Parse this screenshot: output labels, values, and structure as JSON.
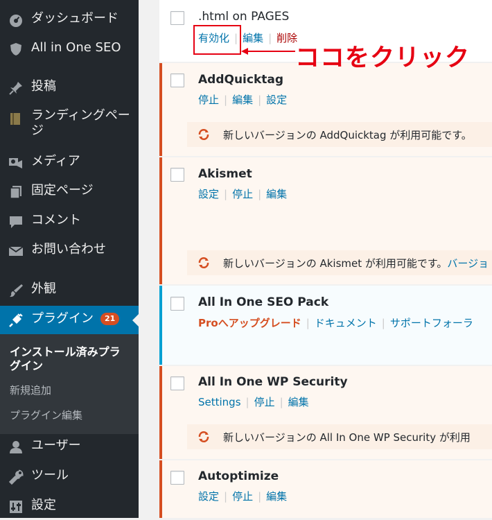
{
  "sidebar": {
    "items": [
      {
        "label": "ダッシュボード",
        "icon": "dashboard-icon"
      },
      {
        "label": "All in One SEO",
        "icon": "shield-icon"
      },
      {
        "label": "投稿",
        "icon": "pin-icon"
      },
      {
        "label": "ランディングページ",
        "icon": "book-icon"
      },
      {
        "label": "メディア",
        "icon": "media-icon"
      },
      {
        "label": "固定ページ",
        "icon": "pages-icon"
      },
      {
        "label": "コメント",
        "icon": "comment-icon"
      },
      {
        "label": "お問い合わせ",
        "icon": "mail-icon"
      },
      {
        "label": "外観",
        "icon": "brush-icon"
      },
      {
        "label": "プラグイン",
        "icon": "plugin-icon",
        "badge": "21"
      },
      {
        "label": "ユーザー",
        "icon": "user-icon"
      },
      {
        "label": "ツール",
        "icon": "wrench-icon"
      },
      {
        "label": "設定",
        "icon": "settings-icon"
      }
    ],
    "submenu": [
      "インストール済みプラグイン",
      "新規追加",
      "プラグイン編集"
    ]
  },
  "plugins": [
    {
      "name": ".html on PAGES",
      "actions": [
        "有効化",
        "編集",
        "削除"
      ]
    },
    {
      "name": "AddQuicktag",
      "actions": [
        "停止",
        "編集",
        "設定"
      ],
      "notice": "新しいバージョンの AddQuicktag が利用可能です。"
    },
    {
      "name": "Akismet",
      "actions": [
        "設定",
        "停止",
        "編集"
      ],
      "notice_prefix": "新しいバージョンの Akismet が利用可能です。",
      "notice_link": "バージョ"
    },
    {
      "name": "All In One SEO Pack",
      "actions": [
        "Proへアップグレード",
        "ドキュメント",
        "サポートフォーラ"
      ]
    },
    {
      "name": "All In One WP Security",
      "actions": [
        "Settings",
        "停止",
        "編集"
      ],
      "notice": "新しいバージョンの All In One WP Security が利用"
    },
    {
      "name": "Autoptimize",
      "actions": [
        "設定",
        "停止",
        "編集"
      ]
    }
  ],
  "annotation": "ココをクリック",
  "colors": {
    "sidebar": "#23282d",
    "active": "#0073aa",
    "update_border": "#d54e21",
    "annotation": "#e60012"
  }
}
